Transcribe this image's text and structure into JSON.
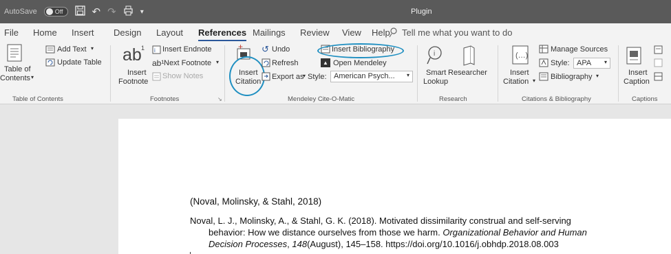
{
  "titlebar": {
    "autosave_label": "AutoSave",
    "autosave_state": "Off",
    "document_title": "Plugin"
  },
  "tabs": [
    "File",
    "Home",
    "Insert",
    "Design",
    "Layout",
    "References",
    "Mailings",
    "Review",
    "View",
    "Help"
  ],
  "active_tab": "References",
  "tell_me": "Tell me what you want to do",
  "ribbon": {
    "toc": {
      "table_of_contents": "Table of",
      "table_of_contents_2": "Contents",
      "add_text": "Add Text",
      "update_table": "Update Table",
      "group_label": "Table of Contents"
    },
    "footnotes": {
      "insert_footnote_1": "Insert",
      "insert_footnote_2": "Footnote",
      "ab_icon_text": "ab",
      "insert_endnote": "Insert Endnote",
      "next_footnote": "Next Footnote",
      "show_notes": "Show Notes",
      "group_label": "Footnotes"
    },
    "mendeley": {
      "insert_citation_1": "Insert",
      "insert_citation_2": "Citation",
      "undo": "Undo",
      "refresh": "Refresh",
      "export_as": "Export as",
      "insert_bibliography": "Insert Bibliography",
      "open_mendeley": "Open Mendeley",
      "style_label": "Style:",
      "style_value": "American Psych...",
      "group_label": "Mendeley Cite-O-Matic"
    },
    "research": {
      "smart_lookup_1": "Smart",
      "smart_lookup_2": "Lookup",
      "researcher": "Researcher",
      "group_label": "Research"
    },
    "citations": {
      "insert_citation_1": "Insert",
      "insert_citation_2": "Citation",
      "manage_sources": "Manage Sources",
      "style_label": "Style:",
      "style_value": "APA",
      "bibliography": "Bibliography",
      "group_label": "Citations & Bibliography"
    },
    "captions": {
      "insert_caption_1": "Insert",
      "insert_caption_2": "Caption",
      "group_label": "Captions"
    }
  },
  "document": {
    "in_text_citation": "(Noval, Molinsky, & Stahl, 2018)",
    "reference_line1": "Noval, L. J., Molinsky, A., & Stahl, G. K. (2018). Motivated dissimilarity construal and self-serving",
    "reference_line2_plain": "behavior: How we distance ourselves from those we harm. ",
    "reference_line2_italic": "Organizational Behavior and Human",
    "reference_line3_italic": "Decision Processes",
    "reference_line3_sep": ", ",
    "reference_line3_volume": "148",
    "reference_line3_rest": "(August), 145–158. https://doi.org/10.1016/j.obhdp.2018.08.003"
  },
  "colors": {
    "highlight_ring": "#1f8fc1",
    "titlebar": "#5a5a5a",
    "accent": "#2b579a"
  }
}
